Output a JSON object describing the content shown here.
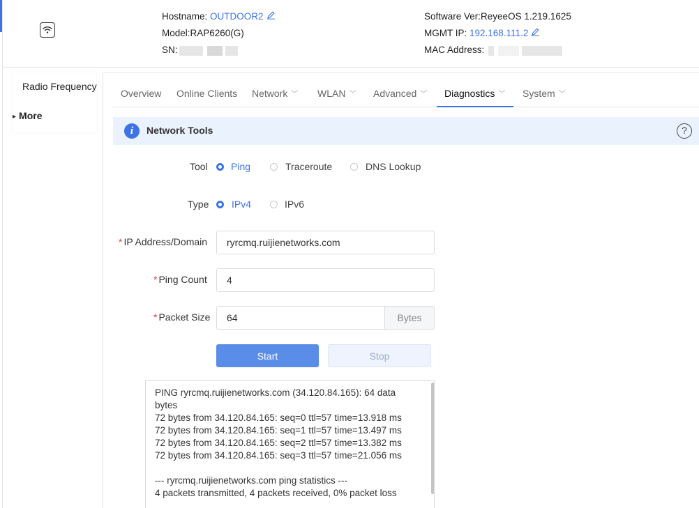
{
  "header": {
    "hostname_label": "Hostname: ",
    "hostname_value": "OUTDOOR2",
    "model": "Model:RAP6260(G)",
    "sn_label": "SN:",
    "software": "Software Ver:ReyeeOS 1.219.1625",
    "mgmt_ip_label": "MGMT IP: ",
    "mgmt_ip_value": "192.168.111.2",
    "mac_label": "MAC Address: "
  },
  "sidebar": {
    "items": [
      {
        "label": "Radio Frequency"
      },
      {
        "label": "More"
      }
    ]
  },
  "tabs": [
    {
      "label": "Overview"
    },
    {
      "label": "Online Clients"
    },
    {
      "label": "Network"
    },
    {
      "label": "WLAN"
    },
    {
      "label": "Advanced"
    },
    {
      "label": "Diagnostics"
    },
    {
      "label": "System"
    }
  ],
  "section": {
    "title": "Network Tools",
    "help": "?"
  },
  "form": {
    "tool_label": "Tool",
    "tool_options": [
      "Ping",
      "Traceroute",
      "DNS Lookup"
    ],
    "type_label": "Type",
    "type_options": [
      "IPv4",
      "IPv6"
    ],
    "ip_label": "IP Address/Domain",
    "ip_value": "ryrcmq.ruijienetworks.com",
    "count_label": "Ping Count",
    "count_value": "4",
    "size_label": "Packet Size",
    "size_value": "64",
    "size_unit": "Bytes",
    "required_mark": "*"
  },
  "buttons": {
    "start": "Start",
    "stop": "Stop"
  },
  "output": {
    "lines": [
      "PING ryrcmq.ruijienetworks.com (34.120.84.165): 64 data bytes",
      "72 bytes from 34.120.84.165: seq=0 ttl=57 time=13.918 ms",
      "72 bytes from 34.120.84.165: seq=1 ttl=57 time=13.497 ms",
      "72 bytes from 34.120.84.165: seq=2 ttl=57 time=13.382 ms",
      "72 bytes from 34.120.84.165: seq=3 ttl=57 time=21.056 ms",
      "",
      "--- ryrcmq.ruijienetworks.com ping statistics ---",
      "4 packets transmitted, 4 packets received, 0% packet loss"
    ]
  },
  "colors": {
    "accent": "#3c74e6",
    "required": "#e03c3c",
    "section_bg": "#eaf3fd"
  }
}
